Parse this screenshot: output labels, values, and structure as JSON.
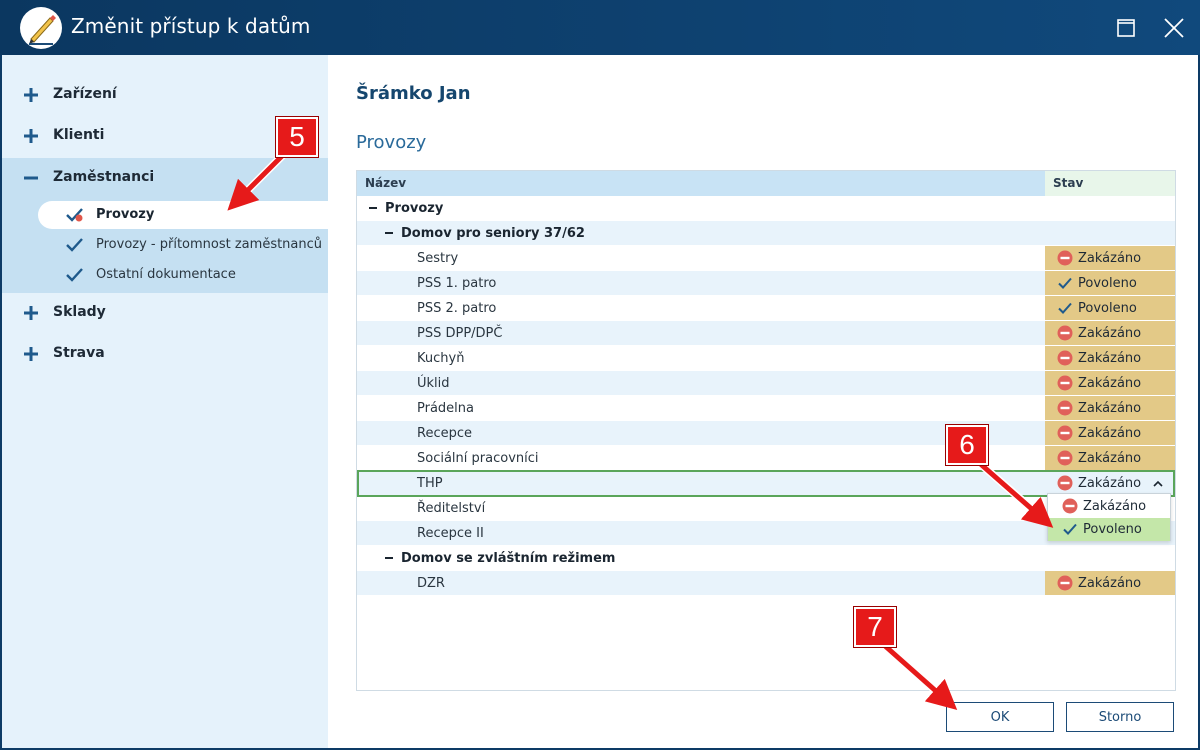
{
  "window": {
    "title": "Změnit přístup k datům",
    "icons": {
      "app": "pencil-icon",
      "maximize": "maximize-icon",
      "close": "close-icon"
    }
  },
  "sidebar": {
    "items": [
      {
        "label": "Zařízení",
        "expanded": false
      },
      {
        "label": "Klienti",
        "expanded": false
      },
      {
        "label": "Zaměstnanci",
        "expanded": true,
        "children": [
          {
            "label": "Provozy",
            "active": true
          },
          {
            "label": "Provozy - přítomnost zaměstnanců",
            "active": false
          },
          {
            "label": "Ostatní dokumentace",
            "active": false
          }
        ]
      },
      {
        "label": "Sklady",
        "expanded": false
      },
      {
        "label": "Strava",
        "expanded": false
      }
    ]
  },
  "main": {
    "person": "Šrámko Jan",
    "section_title": "Provozy",
    "table": {
      "columns": {
        "name": "Název",
        "state": "Stav"
      },
      "rows": [
        {
          "level": 0,
          "label": "Provozy",
          "group": true,
          "state": ""
        },
        {
          "level": 1,
          "label": "Domov pro seniory 37/62",
          "group": true,
          "state": ""
        },
        {
          "level": 2,
          "label": "Sestry",
          "state": "Zakázáno"
        },
        {
          "level": 2,
          "label": "PSS 1. patro",
          "state": "Povoleno"
        },
        {
          "level": 2,
          "label": "PSS 2. patro",
          "state": "Povoleno"
        },
        {
          "level": 2,
          "label": "PSS DPP/DPČ",
          "state": "Zakázáno"
        },
        {
          "level": 2,
          "label": "Kuchyň",
          "state": "Zakázáno"
        },
        {
          "level": 2,
          "label": "Úklid",
          "state": "Zakázáno"
        },
        {
          "level": 2,
          "label": "Prádelna",
          "state": "Zakázáno"
        },
        {
          "level": 2,
          "label": "Recepce",
          "state": "Zakázáno"
        },
        {
          "level": 2,
          "label": "Sociální pracovníci",
          "state": "Zakázáno"
        },
        {
          "level": 2,
          "label": "THP",
          "state": "Zakázáno",
          "selected": true
        },
        {
          "level": 2,
          "label": "Ředitelství",
          "state": ""
        },
        {
          "level": 2,
          "label": "Recepce II",
          "state": ""
        },
        {
          "level": 1,
          "label": "Domov se zvláštním režimem",
          "group": true,
          "state": ""
        },
        {
          "level": 2,
          "label": "DZR",
          "state": "Zakázáno"
        }
      ],
      "dropdown": {
        "current": "Zakázáno",
        "options": [
          {
            "label": "Zakázáno",
            "highlighted": false
          },
          {
            "label": "Povoleno",
            "highlighted": true
          }
        ]
      }
    },
    "buttons": {
      "ok": "OK",
      "cancel": "Storno"
    }
  },
  "annotations": {
    "step5": "5",
    "step6": "6",
    "step7": "7"
  },
  "colors": {
    "titlebar": "#0b3760",
    "sidebar_bg": "#e5f2fb",
    "state_cell": "#e3c987",
    "selection_border": "#5aa55a",
    "dropdown_highlight": "#c4e7a9",
    "callout": "#e61a1a"
  }
}
